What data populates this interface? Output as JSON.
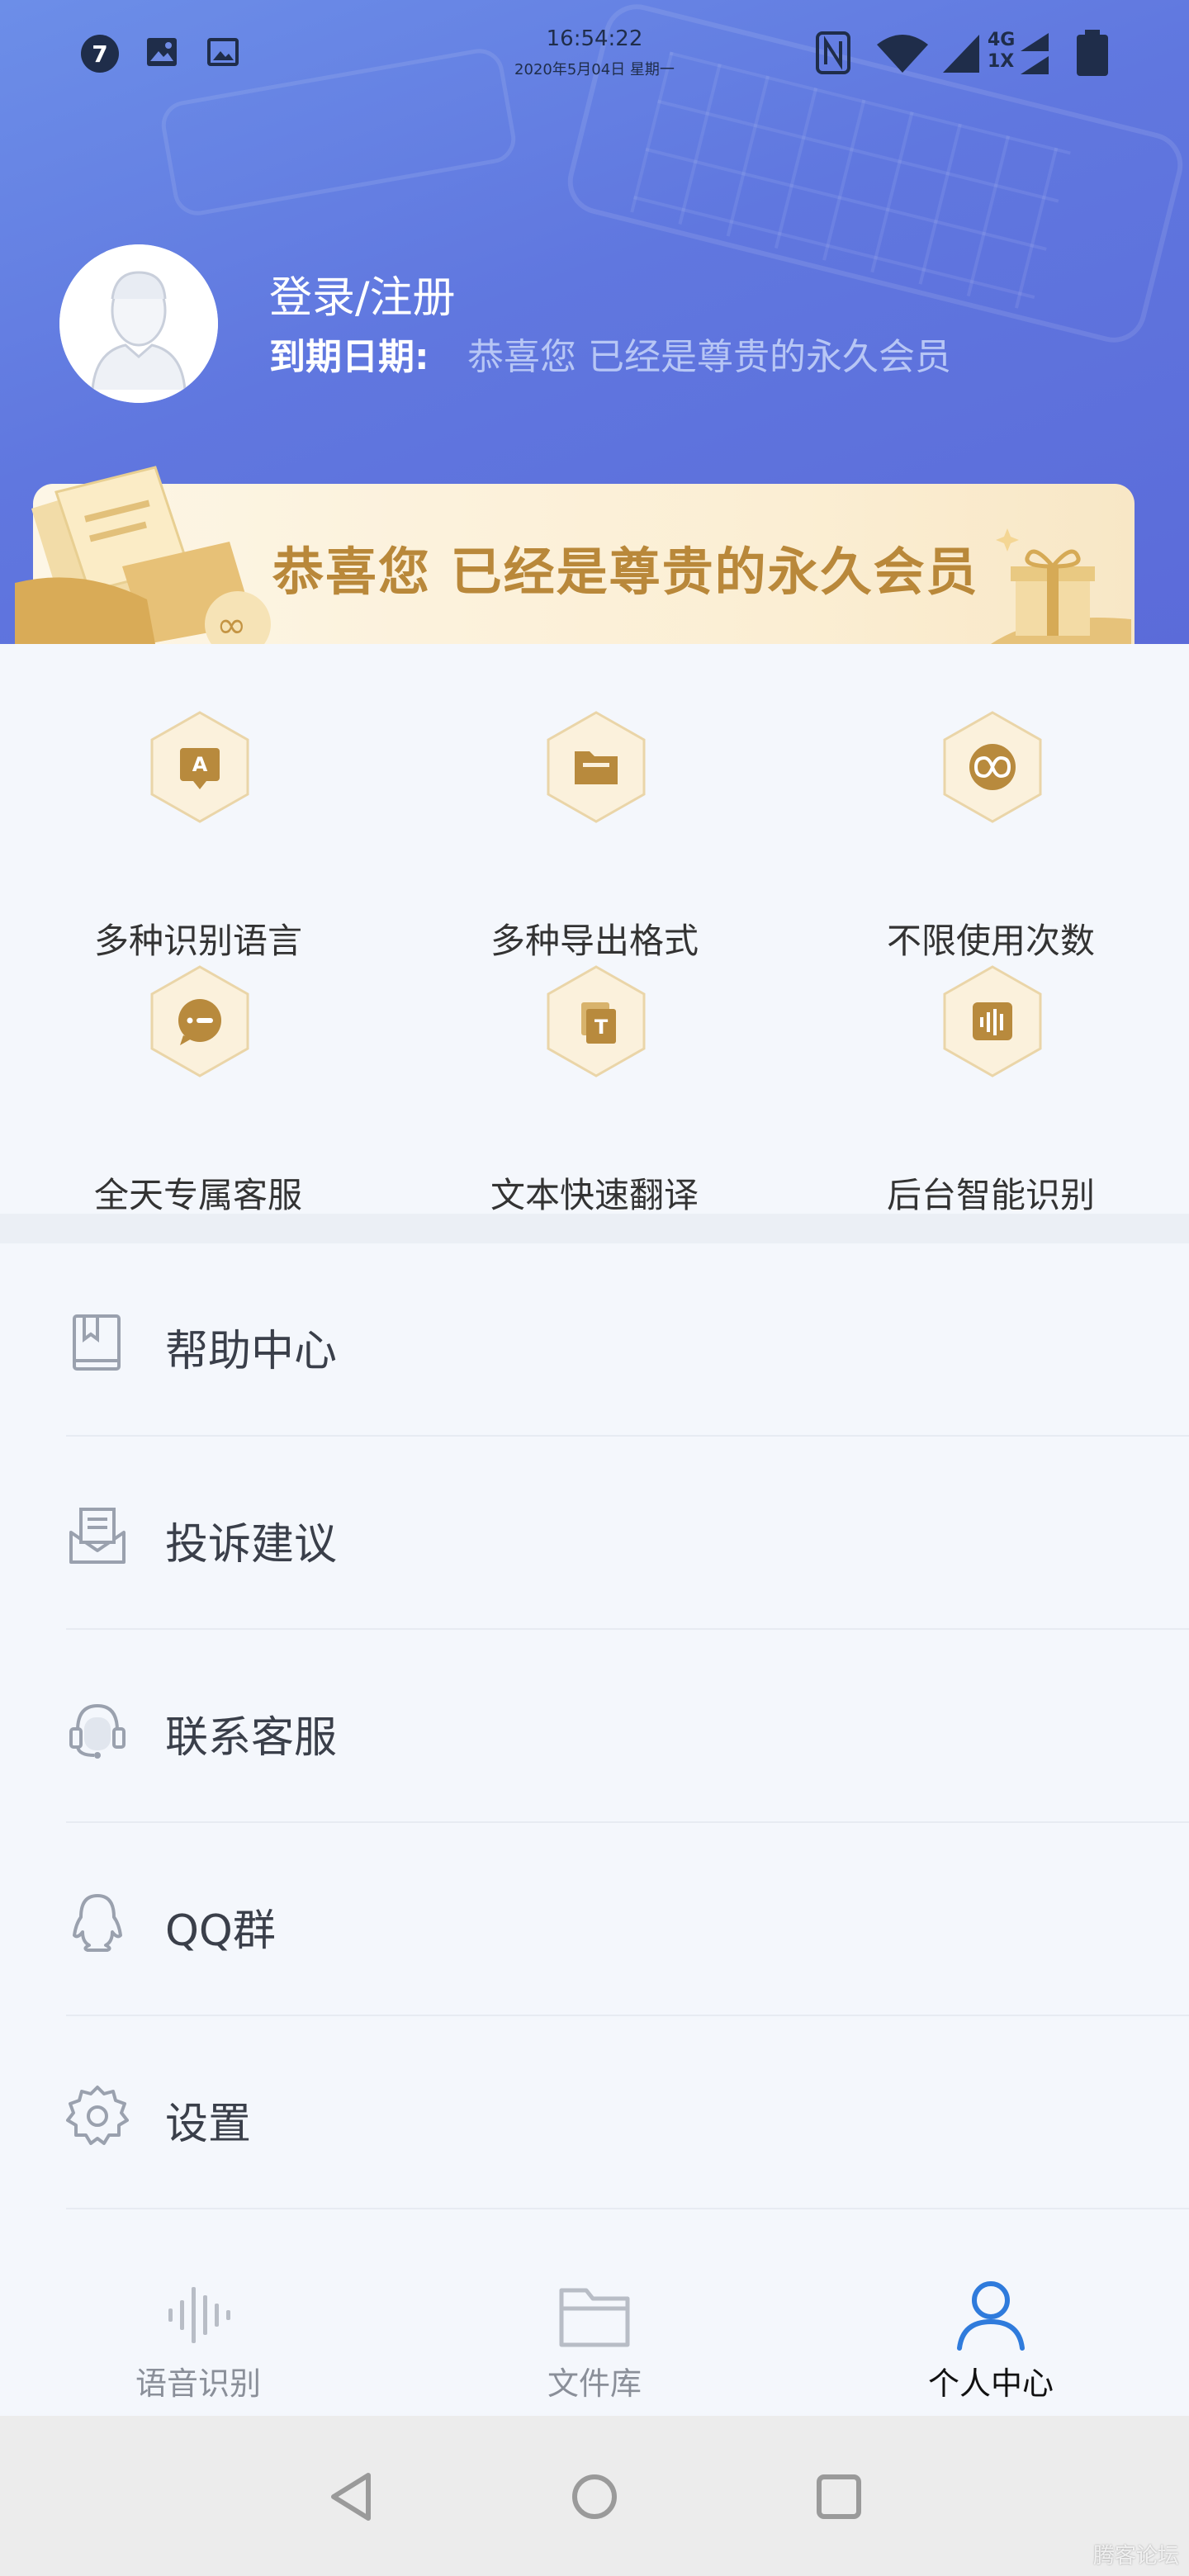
{
  "status_bar": {
    "notification_count": "7",
    "time": "16:54:22",
    "date": "2020年5月04日 星期一",
    "network": "4G",
    "network2": "1X"
  },
  "profile": {
    "login_label": "登录/注册",
    "expire_label": "到期日期:",
    "expire_value": "恭喜您 已经是尊贵的永久会员"
  },
  "vip_banner": {
    "text": "恭喜您 已经是尊贵的永久会员"
  },
  "features": [
    {
      "label": "多种识别语言",
      "icon": "language-icon"
    },
    {
      "label": "多种导出格式",
      "icon": "folder-icon"
    },
    {
      "label": "不限使用次数",
      "icon": "infinity-icon"
    },
    {
      "label": "全天专属客服",
      "icon": "chat-icon"
    },
    {
      "label": "文本快速翻译",
      "icon": "translate-icon"
    },
    {
      "label": "后台智能识别",
      "icon": "waveform-icon"
    }
  ],
  "menu": [
    {
      "label": "帮助中心",
      "icon": "book-icon"
    },
    {
      "label": "投诉建议",
      "icon": "mail-icon"
    },
    {
      "label": "联系客服",
      "icon": "headset-icon"
    },
    {
      "label": "QQ群",
      "icon": "qq-icon"
    },
    {
      "label": "设置",
      "icon": "gear-icon"
    }
  ],
  "tabs": [
    {
      "label": "语音识别",
      "icon": "waveform-icon",
      "active": false
    },
    {
      "label": "文件库",
      "icon": "folder-icon",
      "active": false
    },
    {
      "label": "个人中心",
      "icon": "user-icon",
      "active": true
    }
  ],
  "colors": {
    "header_start": "#6c8ee8",
    "header_end": "#5b6bd9",
    "gold": "#b9883a",
    "active_tab": "#2f7bdc"
  },
  "watermark": "腾客论坛"
}
